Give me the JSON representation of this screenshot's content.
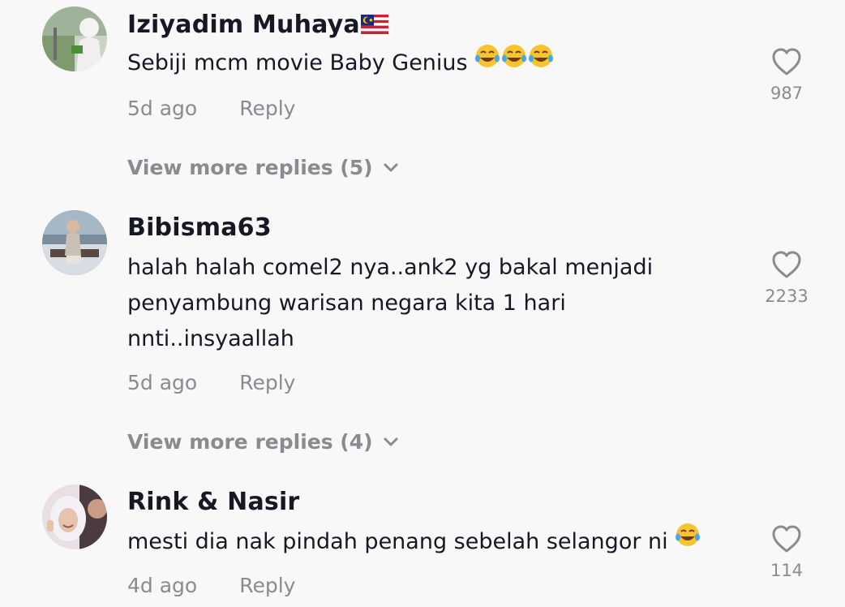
{
  "comments": [
    {
      "username": "Iziyadim Muhaya",
      "text": "Sebiji mcm movie Baby Genius",
      "time": "5d ago",
      "reply_label": "Reply",
      "likes": "987",
      "view_more": "View more replies (5)"
    },
    {
      "username": "Bibisma63",
      "text": "halah halah comel2 nya..ank2 yg bakal menjadi penyambung warisan negara kita 1 hari nnti..insyaallah",
      "time": "5d ago",
      "reply_label": "Reply",
      "likes": "2233",
      "view_more": "View more replies (4)"
    },
    {
      "username": "Rink & Nasir",
      "text": "mesti dia nak pindah penang sebelah selangor ni",
      "time": "4d ago",
      "reply_label": "Reply",
      "likes": "114"
    }
  ],
  "icons": {
    "like": "heart-outline-icon",
    "expand": "chevron-down-icon",
    "emoji": "face-with-tears-of-joy-emoji",
    "flag": "malaysia-flag-emoji"
  },
  "colors": {
    "background": "#f8f8f8",
    "primary_text": "#161823",
    "secondary_text": "#8a8b91"
  }
}
